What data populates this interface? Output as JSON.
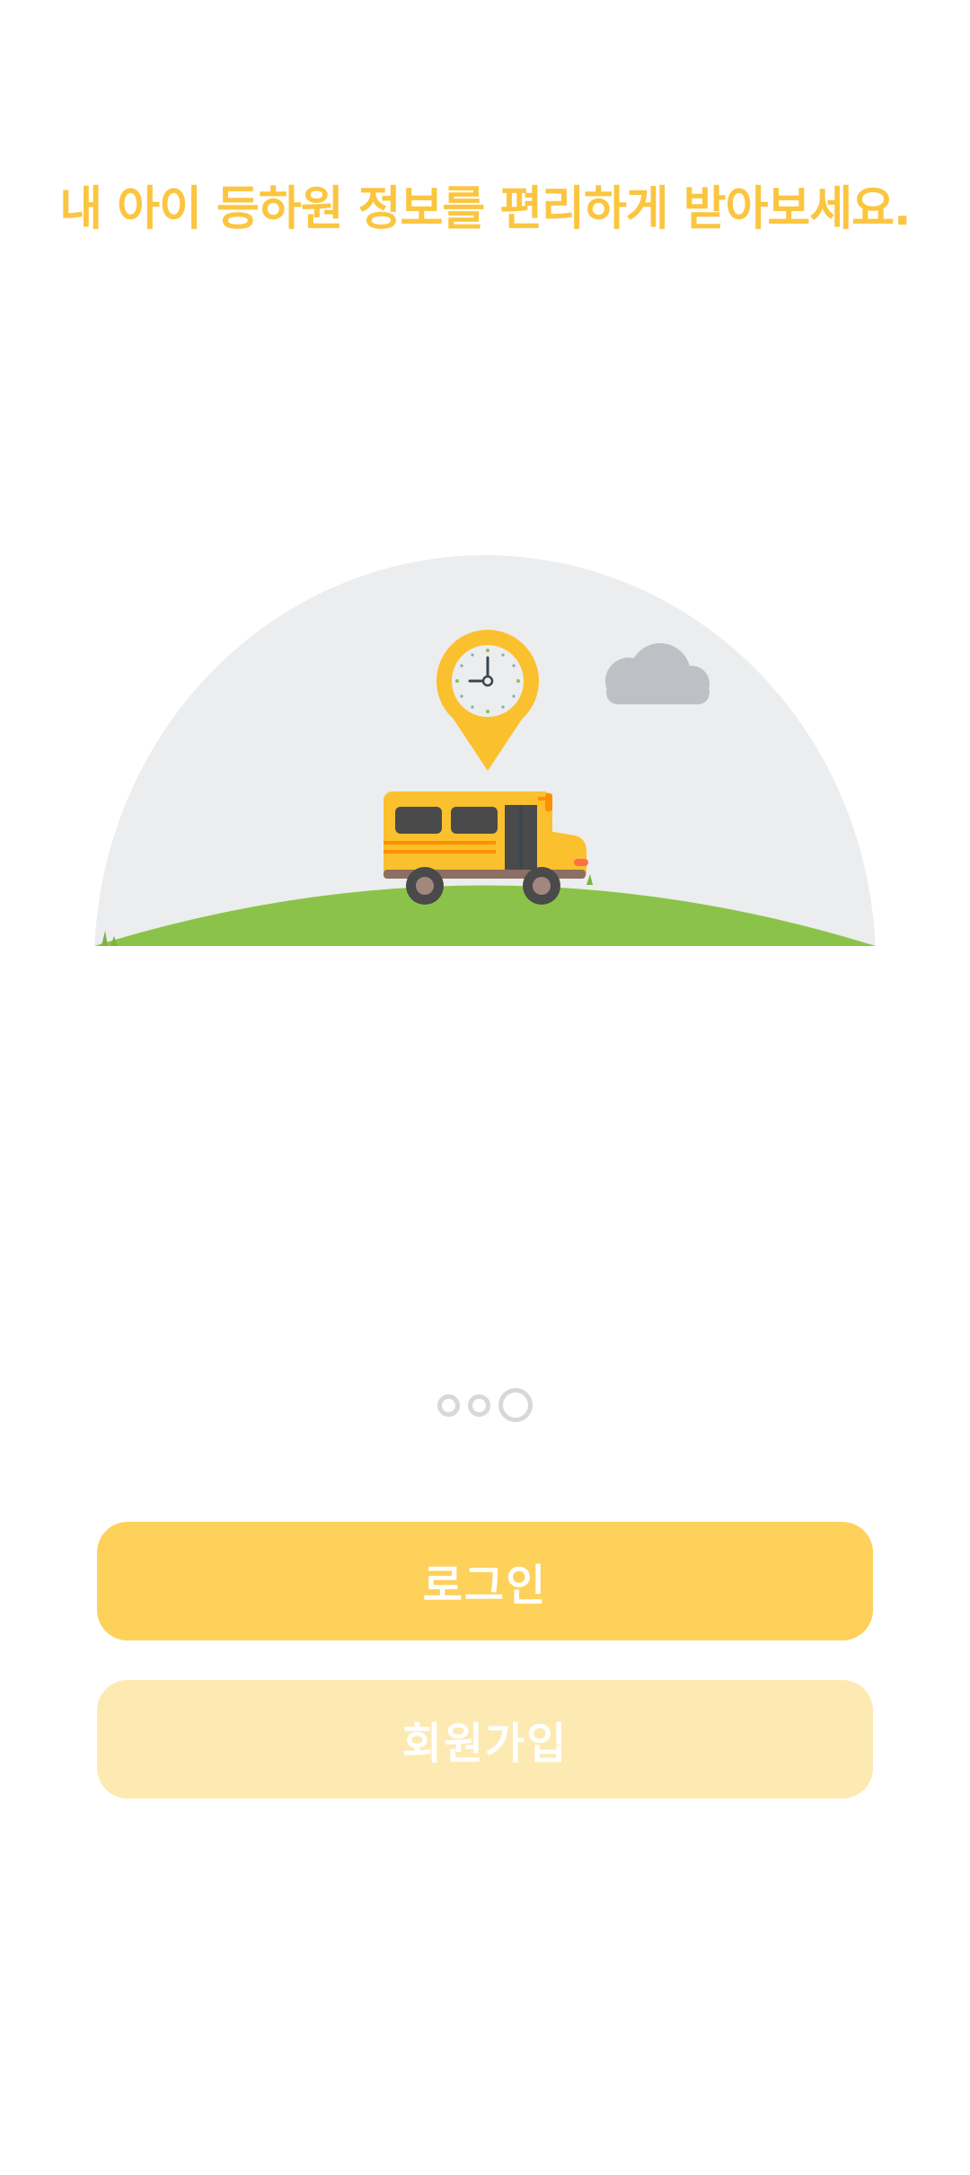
{
  "headline": {
    "text": "내 아이 등하원 정보를 편리하게 받아보세요.",
    "color": "#FBC53F"
  },
  "illustration": {
    "scene_icons": [
      "school-bus-icon",
      "clock-location-pin-icon",
      "cloud-icon",
      "grass-hill"
    ],
    "colors": {
      "sky_dome": "#ECEDEE",
      "grass": "#8BC34A",
      "bus": "#FBC02D",
      "pin": "#FBC02D",
      "cloud": "#BDC0C4"
    }
  },
  "pager": {
    "count": 3,
    "active_index": 2,
    "color": "#D8D8D8"
  },
  "buttons": {
    "login_label": "로그인",
    "login_color": "#FDD15A",
    "signup_label": "회원가입",
    "signup_color": "#FDEAB3"
  }
}
